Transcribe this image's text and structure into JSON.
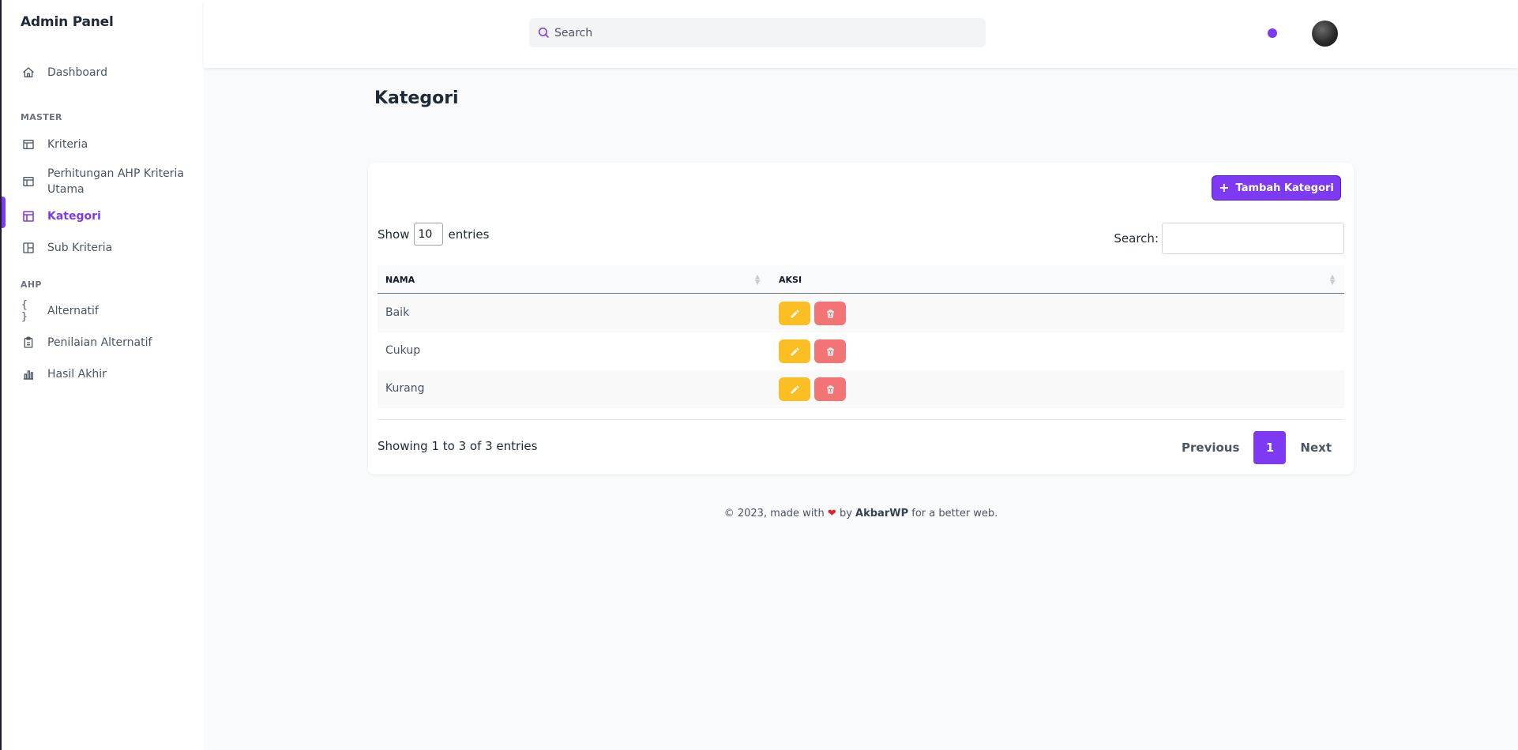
{
  "app": {
    "brand": "Admin Panel"
  },
  "sidebar": {
    "items": [
      {
        "label": "Dashboard",
        "icon": "home-icon"
      },
      {
        "label": "Kriteria",
        "icon": "table-icon"
      },
      {
        "label": "Perhitungan AHP Kriteria Utama",
        "label_line1": "Perhitungan AHP Kriteria",
        "label_line2": "Utama",
        "icon": "table-icon"
      },
      {
        "label": "Kategori",
        "icon": "layout-icon",
        "active": true
      },
      {
        "label": "Sub Kriteria",
        "icon": "layout-grid-icon"
      },
      {
        "label": "Alternatif",
        "icon": "code-braces-icon"
      },
      {
        "label": "Penilaian Alternatif",
        "icon": "clipboard-icon"
      },
      {
        "label": "Hasil Akhir",
        "icon": "bar-chart-icon"
      }
    ],
    "sections": {
      "master": "MASTER",
      "ahp": "AHP"
    }
  },
  "header": {
    "search_placeholder": "Search",
    "accent_color": "#7e3af2"
  },
  "page": {
    "title": "Kategori"
  },
  "toolbar": {
    "add_label": "Tambah Kategori"
  },
  "datatable": {
    "show_label": "Show",
    "page_size": "10",
    "entries_label": "entries",
    "search_label": "Search:",
    "columns": [
      "NAMA",
      "AKSI"
    ],
    "rows": [
      {
        "nama": "Baik"
      },
      {
        "nama": "Cukup"
      },
      {
        "nama": "Kurang"
      }
    ],
    "info": "Showing 1 to 3 of 3 entries",
    "pagination": {
      "previous": "Previous",
      "current": "1",
      "next": "Next"
    }
  },
  "footer": {
    "prefix": "© 2023, made with",
    "by": "by",
    "author": "AkbarWP",
    "suffix": "for a better web."
  },
  "colors": {
    "primary": "#7e3af2",
    "edit": "#fbbf24",
    "delete": "#f27474"
  }
}
